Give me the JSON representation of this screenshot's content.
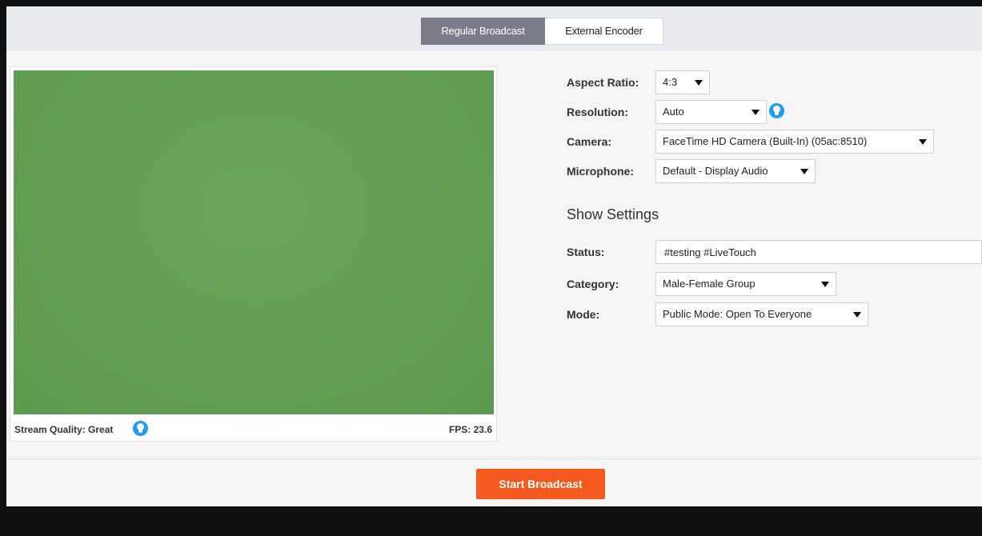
{
  "tabs": {
    "regular": "Regular Broadcast",
    "external": "External Encoder"
  },
  "preview": {
    "stream_quality": "Stream Quality: Great",
    "fps": "FPS: 23.6"
  },
  "settings": {
    "aspect_ratio_label": "Aspect Ratio:",
    "aspect_ratio_value": "4:3",
    "resolution_label": "Resolution:",
    "resolution_value": "Auto",
    "camera_label": "Camera:",
    "camera_value": "FaceTime HD Camera (Built-In) (05ac:8510)",
    "microphone_label": "Microphone:",
    "microphone_value": "Default - Display Audio"
  },
  "show_settings": {
    "title": "Show Settings",
    "status_label": "Status:",
    "status_value": "#testing #LiveTouch",
    "category_label": "Category:",
    "category_value": "Male-Female Group",
    "mode_label": "Mode:",
    "mode_value": "Public Mode: Open To Everyone"
  },
  "actions": {
    "start_broadcast": "Start Broadcast"
  },
  "colors": {
    "accent": "#f45a1d",
    "active_tab": "#7a7c8a",
    "video_bg": "#629f54",
    "info_icon": "#1f9bf0"
  }
}
